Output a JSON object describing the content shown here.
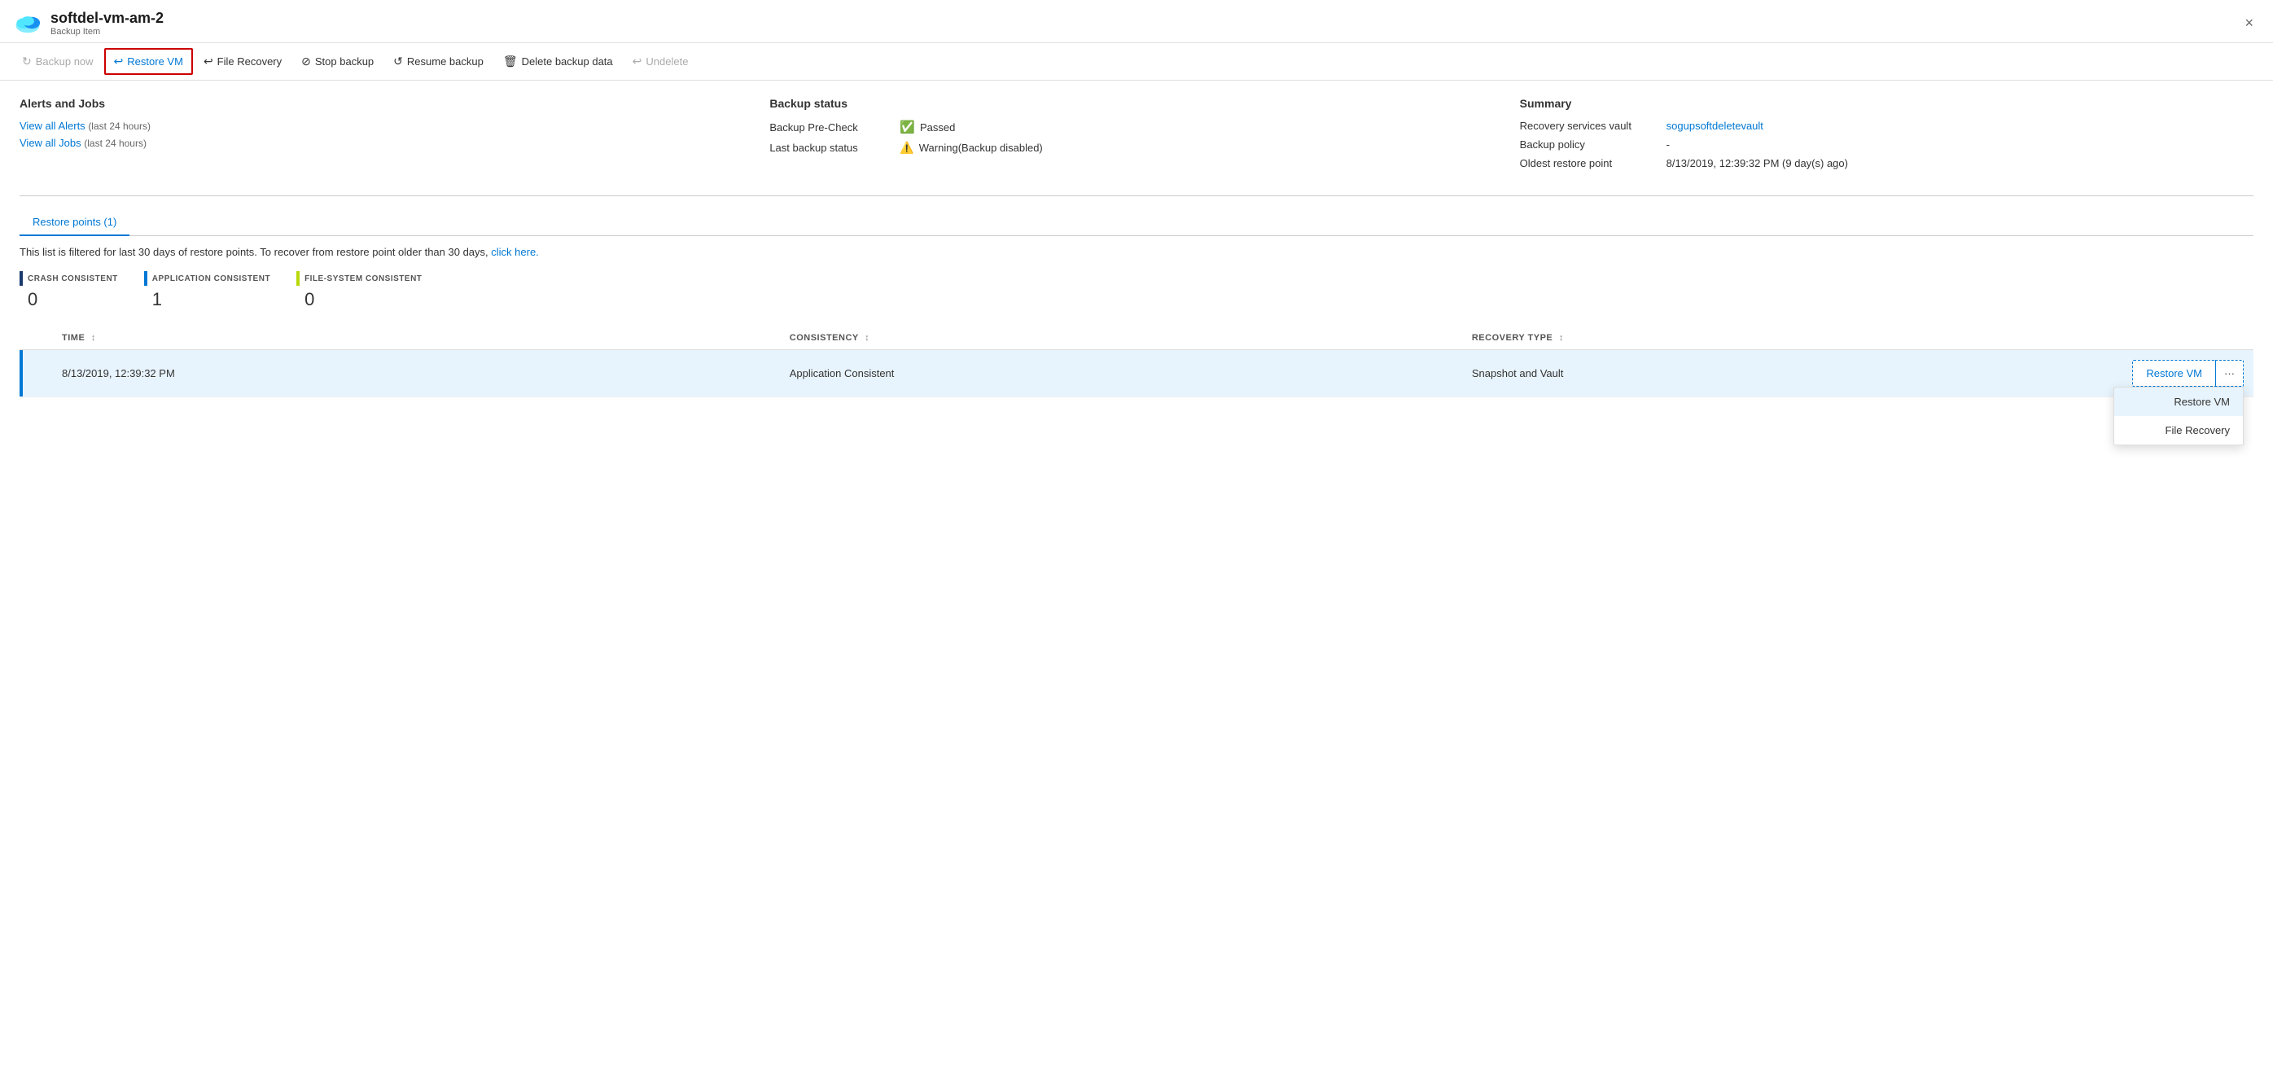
{
  "header": {
    "title": "softdel-vm-am-2",
    "subtitle": "Backup Item",
    "close_label": "×"
  },
  "toolbar": {
    "buttons": [
      {
        "id": "backup-now",
        "label": "Backup now",
        "icon": "⟳",
        "disabled": true
      },
      {
        "id": "restore-vm",
        "label": "Restore VM",
        "icon": "↩",
        "active": true,
        "disabled": false
      },
      {
        "id": "file-recovery",
        "label": "File Recovery",
        "icon": "↩",
        "disabled": false
      },
      {
        "id": "stop-backup",
        "label": "Stop backup",
        "icon": "⊘",
        "disabled": false
      },
      {
        "id": "resume-backup",
        "label": "Resume backup",
        "icon": "↺",
        "disabled": false
      },
      {
        "id": "delete-backup",
        "label": "Delete backup data",
        "icon": "🗑",
        "disabled": false
      },
      {
        "id": "undelete",
        "label": "Undelete",
        "icon": "↩",
        "disabled": true
      }
    ]
  },
  "alerts": {
    "section_title": "Alerts and Jobs",
    "view_alerts_label": "View all Alerts",
    "view_alerts_sub": "(last 24 hours)",
    "view_jobs_label": "View all Jobs",
    "view_jobs_sub": "(last 24 hours)"
  },
  "backup_status": {
    "section_title": "Backup status",
    "rows": [
      {
        "label": "Backup Pre-Check",
        "value": "Passed",
        "status": "passed"
      },
      {
        "label": "Last backup status",
        "value": "Warning(Backup disabled)",
        "status": "warning"
      }
    ]
  },
  "summary": {
    "section_title": "Summary",
    "rows": [
      {
        "label": "Recovery services vault",
        "value": "sogupsoftdeletevault",
        "is_link": true
      },
      {
        "label": "Backup policy",
        "value": "-",
        "is_link": false
      },
      {
        "label": "Oldest restore point",
        "value": "8/13/2019, 12:39:32 PM (9 day(s) ago)",
        "is_link": false
      }
    ]
  },
  "restore_points": {
    "tab_label": "Restore points (1)",
    "filter_text": "This list is filtered for last 30 days of restore points. To recover from restore point older than 30 days,",
    "filter_link_label": "click here.",
    "legend": [
      {
        "label": "CRASH CONSISTENT",
        "color": "#1a3a6e",
        "count": "0"
      },
      {
        "label": "APPLICATION CONSISTENT",
        "color": "#0078d4",
        "count": "1"
      },
      {
        "label": "FILE-SYSTEM CONSISTENT",
        "color": "#bad80a",
        "count": "0"
      }
    ],
    "table": {
      "columns": [
        {
          "id": "time",
          "label": "TIME",
          "sortable": true
        },
        {
          "id": "consistency",
          "label": "CONSISTENCY",
          "sortable": true
        },
        {
          "id": "recovery_type",
          "label": "RECOVERY TYPE",
          "sortable": true
        }
      ],
      "rows": [
        {
          "time": "8/13/2019, 12:39:32 PM",
          "consistency": "Application Consistent",
          "recovery_type": "Snapshot and Vault",
          "selected": true
        }
      ]
    },
    "actions": {
      "restore_vm_label": "Restore VM",
      "file_recovery_label": "File Recovery",
      "more_icon": "···"
    }
  }
}
